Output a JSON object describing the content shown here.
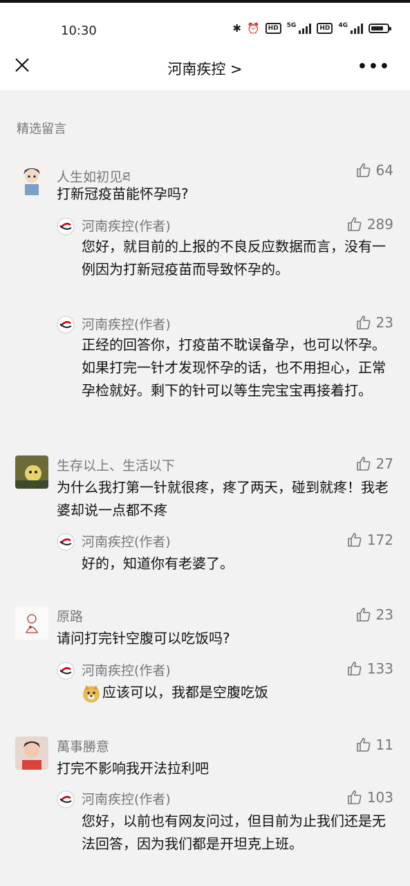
{
  "status": {
    "time": "10:30",
    "net1": "5G",
    "net2": "4G",
    "hd1": "HD",
    "hd2": "HD",
    "battery_level": 0.75
  },
  "nav": {
    "title": "河南疾控 >",
    "more": "•••"
  },
  "section_title": "精选留言",
  "comments": [
    {
      "name": "人生如初见ཐ",
      "likes": "64",
      "text": "打新冠疫苗能怀孕吗?",
      "replies": [
        {
          "name": "河南疾控(作者)",
          "likes": "289",
          "text": "您好，就目前的上报的不良反应数据而言，没有一例因为打新冠疫苗而导致怀孕的。"
        },
        {
          "name": "河南疾控(作者)",
          "likes": "23",
          "text": "正经的回答你，打疫苗不耽误备孕，也可以怀孕。如果打完一针才发现怀孕的话，也不用担心，正常孕检就好。剩下的针可以等生完宝宝再接着打。"
        }
      ]
    },
    {
      "name": "生存以上、生活以下",
      "likes": "27",
      "text": "为什么我打第一针就很疼，疼了两天，碰到就疼！我老婆却说一点都不疼",
      "replies": [
        {
          "name": "河南疾控(作者)",
          "likes": "172",
          "text": "好的，知道你有老婆了。"
        }
      ]
    },
    {
      "name": "原路",
      "likes": "23",
      "text": "请问打完针空腹可以吃饭吗?",
      "replies": [
        {
          "name": "河南疾控(作者)",
          "likes": "133",
          "text": "应该可以，我都是空腹吃饭"
        }
      ]
    },
    {
      "name": "萬事勝意",
      "likes": "11",
      "text": "打完不影响我开法拉利吧",
      "replies": [
        {
          "name": "河南疾控(作者)",
          "likes": "103",
          "text": "您好，以前也有网友问过，但目前为止我们还是无法回答，因为我们都是开坦克上班。"
        }
      ]
    }
  ]
}
